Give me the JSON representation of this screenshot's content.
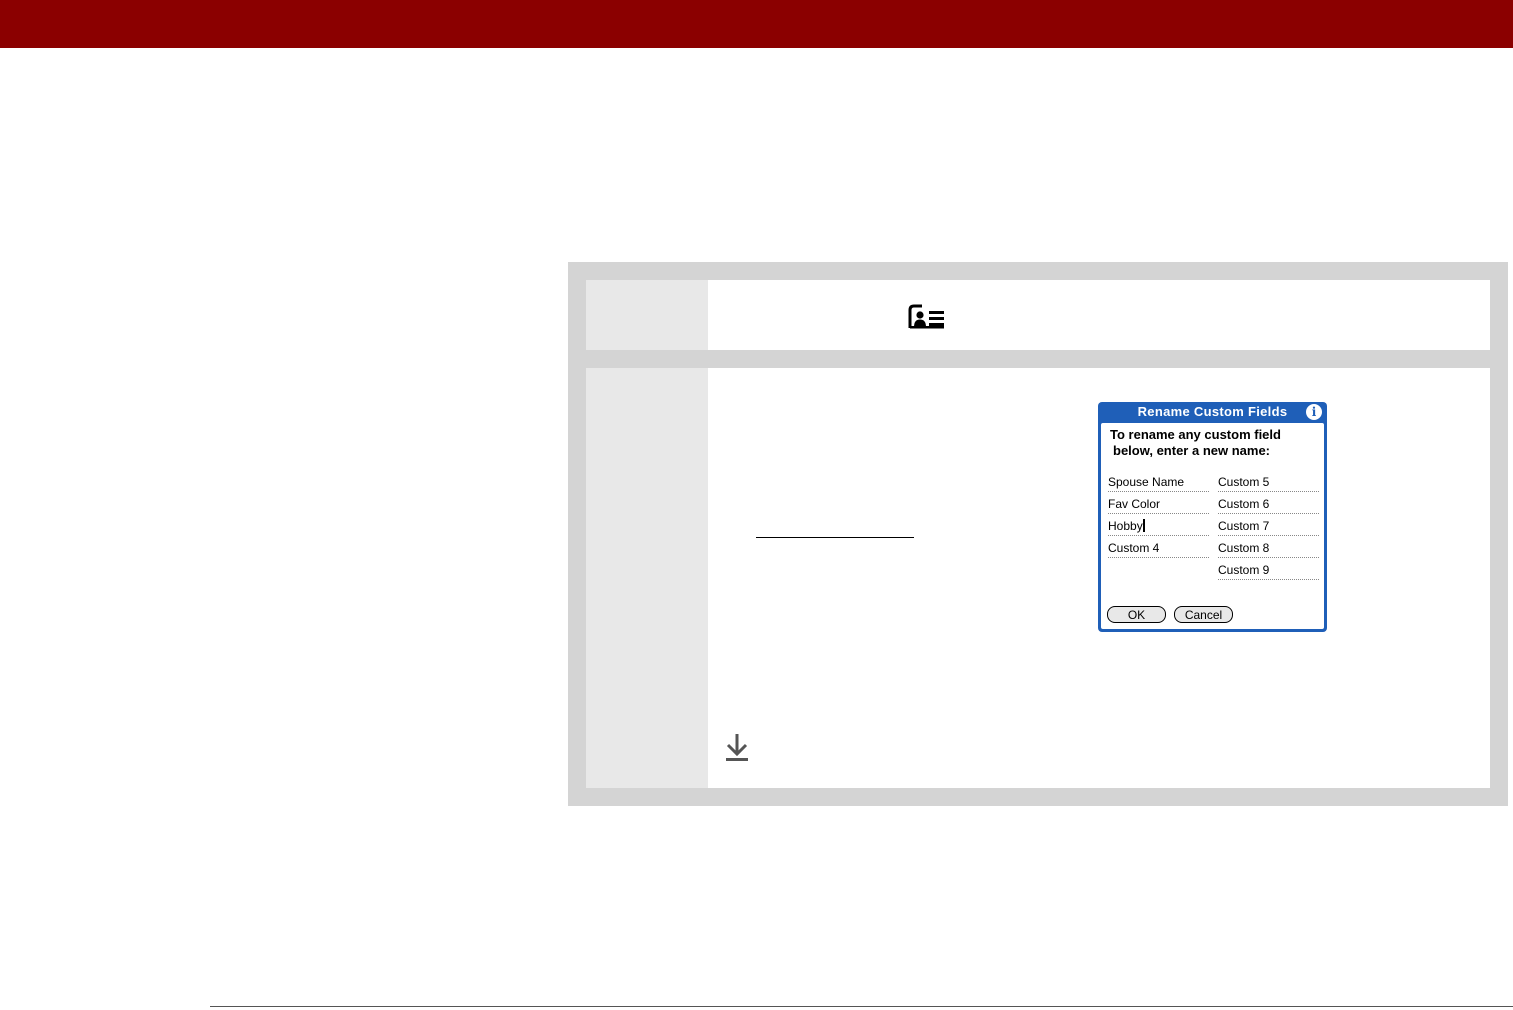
{
  "colors": {
    "header_bar": "#8b0000",
    "procedure_frame": "#d4d4d4",
    "step_number_cell": "#e8e8e8",
    "dialog_blue": "#1f5fb8",
    "icon_gray": "#555555"
  },
  "procedure": {
    "step1": {
      "icon": "contacts-card-icon"
    },
    "step2": {
      "tip_icon": "download-arrow-icon",
      "dialog": {
        "title": "Rename Custom Fields",
        "info_icon_label": "i",
        "instruction_line1": "To rename any custom field",
        "instruction_line2": "below, enter a new name:",
        "fields_left": [
          "Spouse Name",
          "Fav Color",
          "Hobby",
          "Custom 4"
        ],
        "fields_right": [
          "Custom 5",
          "Custom 6",
          "Custom 7",
          "Custom 8",
          "Custom 9"
        ],
        "ok_label": "OK",
        "cancel_label": "Cancel"
      }
    }
  }
}
